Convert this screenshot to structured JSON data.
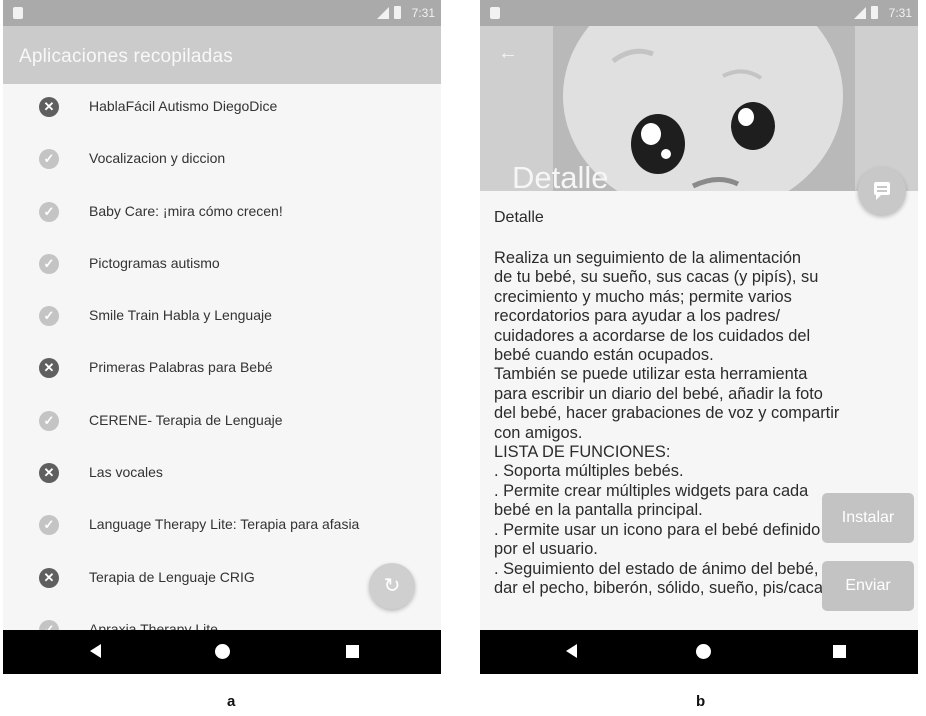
{
  "statusbar": {
    "time": "7:31"
  },
  "screen_a": {
    "title": "Aplicaciones recopiladas",
    "items": [
      {
        "label": "HablaFácil Autismo DiegoDice",
        "status": "fail"
      },
      {
        "label": "Vocalizacion y diccion",
        "status": "ok"
      },
      {
        "label": "Baby Care: ¡mira cómo crecen!",
        "status": "ok"
      },
      {
        "label": "Pictogramas autismo",
        "status": "ok"
      },
      {
        "label": "Smile Train Habla y Lenguaje",
        "status": "ok"
      },
      {
        "label": "Primeras Palabras para Bebé",
        "status": "fail"
      },
      {
        "label": "CERENE- Terapia de Lenguaje",
        "status": "ok"
      },
      {
        "label": "Las vocales",
        "status": "fail"
      },
      {
        "label": "Language Therapy Lite: Terapia para afasia",
        "status": "ok"
      },
      {
        "label": "Terapia de Lenguaje CRIG",
        "status": "fail"
      },
      {
        "label": "Apraxia Therapy Lite",
        "status": "ok"
      }
    ],
    "fab_icon": "refresh-icon"
  },
  "screen_b": {
    "header_title": "Detalle",
    "section_title": "Detalle",
    "description": "Realiza un seguimiento de la alimentación\nde tu bebé, su sueño, sus cacas (y pipís), su\ncrecimiento y mucho más; permite varios\nrecordatorios para ayudar a los padres/\ncuidadores a acordarse de los cuidados del\nbebé cuando están ocupados.\nTambién se puede utilizar esta herramienta\npara escribir un diario del bebé, añadir la foto\ndel bebé, hacer grabaciones de voz y compartir\ncon amigos.\nLISTA DE FUNCIONES:\n. Soporta múltiples bebés.\n. Permite crear múltiples widgets para cada\nbebé en la pantalla principal.\n. Permite usar un icono para el bebé definido\npor el usuario.\n. Seguimiento del estado de ánimo del bebé,\ndar el pecho, biberón, sólido, sueño, pis/caca",
    "install_label": "Instalar",
    "send_label": "Enviar"
  },
  "captions": {
    "a": "a",
    "b": "b"
  }
}
